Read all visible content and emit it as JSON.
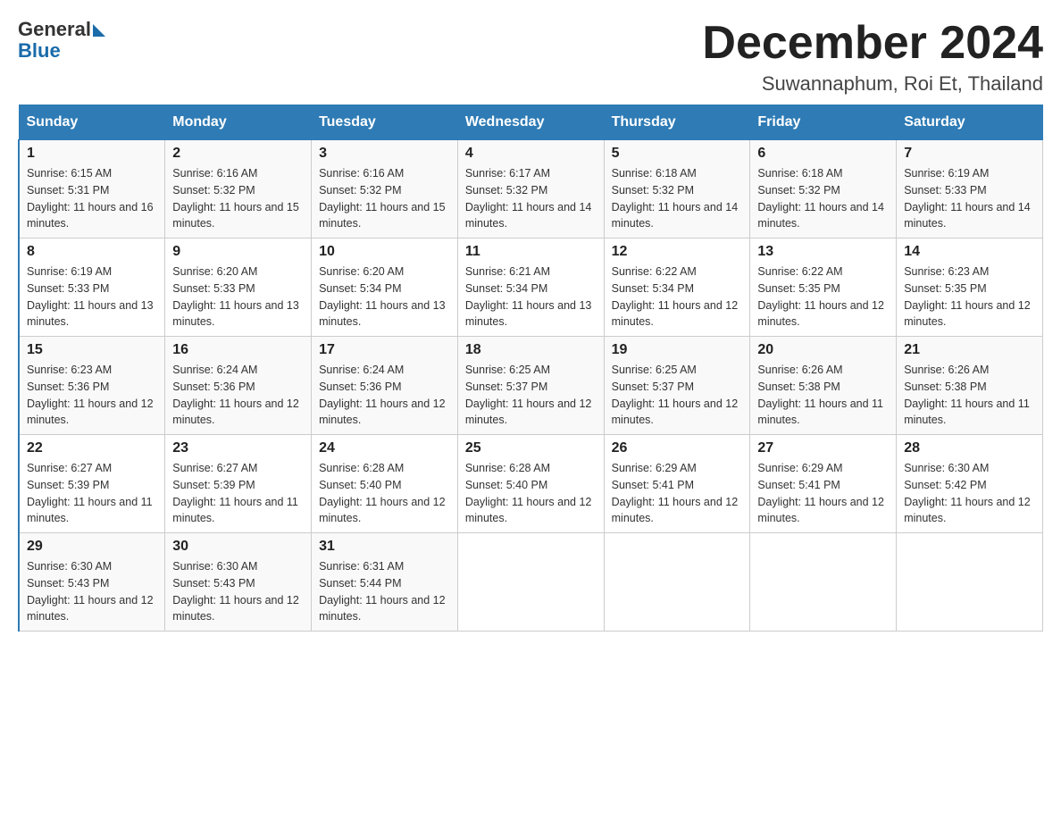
{
  "logo": {
    "general": "General",
    "blue": "Blue"
  },
  "title": "December 2024",
  "subtitle": "Suwannaphum, Roi Et, Thailand",
  "days_of_week": [
    "Sunday",
    "Monday",
    "Tuesday",
    "Wednesday",
    "Thursday",
    "Friday",
    "Saturday"
  ],
  "weeks": [
    [
      {
        "day": "1",
        "sunrise": "6:15 AM",
        "sunset": "5:31 PM",
        "daylight": "11 hours and 16 minutes."
      },
      {
        "day": "2",
        "sunrise": "6:16 AM",
        "sunset": "5:32 PM",
        "daylight": "11 hours and 15 minutes."
      },
      {
        "day": "3",
        "sunrise": "6:16 AM",
        "sunset": "5:32 PM",
        "daylight": "11 hours and 15 minutes."
      },
      {
        "day": "4",
        "sunrise": "6:17 AM",
        "sunset": "5:32 PM",
        "daylight": "11 hours and 14 minutes."
      },
      {
        "day": "5",
        "sunrise": "6:18 AM",
        "sunset": "5:32 PM",
        "daylight": "11 hours and 14 minutes."
      },
      {
        "day": "6",
        "sunrise": "6:18 AM",
        "sunset": "5:32 PM",
        "daylight": "11 hours and 14 minutes."
      },
      {
        "day": "7",
        "sunrise": "6:19 AM",
        "sunset": "5:33 PM",
        "daylight": "11 hours and 14 minutes."
      }
    ],
    [
      {
        "day": "8",
        "sunrise": "6:19 AM",
        "sunset": "5:33 PM",
        "daylight": "11 hours and 13 minutes."
      },
      {
        "day": "9",
        "sunrise": "6:20 AM",
        "sunset": "5:33 PM",
        "daylight": "11 hours and 13 minutes."
      },
      {
        "day": "10",
        "sunrise": "6:20 AM",
        "sunset": "5:34 PM",
        "daylight": "11 hours and 13 minutes."
      },
      {
        "day": "11",
        "sunrise": "6:21 AM",
        "sunset": "5:34 PM",
        "daylight": "11 hours and 13 minutes."
      },
      {
        "day": "12",
        "sunrise": "6:22 AM",
        "sunset": "5:34 PM",
        "daylight": "11 hours and 12 minutes."
      },
      {
        "day": "13",
        "sunrise": "6:22 AM",
        "sunset": "5:35 PM",
        "daylight": "11 hours and 12 minutes."
      },
      {
        "day": "14",
        "sunrise": "6:23 AM",
        "sunset": "5:35 PM",
        "daylight": "11 hours and 12 minutes."
      }
    ],
    [
      {
        "day": "15",
        "sunrise": "6:23 AM",
        "sunset": "5:36 PM",
        "daylight": "11 hours and 12 minutes."
      },
      {
        "day": "16",
        "sunrise": "6:24 AM",
        "sunset": "5:36 PM",
        "daylight": "11 hours and 12 minutes."
      },
      {
        "day": "17",
        "sunrise": "6:24 AM",
        "sunset": "5:36 PM",
        "daylight": "11 hours and 12 minutes."
      },
      {
        "day": "18",
        "sunrise": "6:25 AM",
        "sunset": "5:37 PM",
        "daylight": "11 hours and 12 minutes."
      },
      {
        "day": "19",
        "sunrise": "6:25 AM",
        "sunset": "5:37 PM",
        "daylight": "11 hours and 12 minutes."
      },
      {
        "day": "20",
        "sunrise": "6:26 AM",
        "sunset": "5:38 PM",
        "daylight": "11 hours and 11 minutes."
      },
      {
        "day": "21",
        "sunrise": "6:26 AM",
        "sunset": "5:38 PM",
        "daylight": "11 hours and 11 minutes."
      }
    ],
    [
      {
        "day": "22",
        "sunrise": "6:27 AM",
        "sunset": "5:39 PM",
        "daylight": "11 hours and 11 minutes."
      },
      {
        "day": "23",
        "sunrise": "6:27 AM",
        "sunset": "5:39 PM",
        "daylight": "11 hours and 11 minutes."
      },
      {
        "day": "24",
        "sunrise": "6:28 AM",
        "sunset": "5:40 PM",
        "daylight": "11 hours and 12 minutes."
      },
      {
        "day": "25",
        "sunrise": "6:28 AM",
        "sunset": "5:40 PM",
        "daylight": "11 hours and 12 minutes."
      },
      {
        "day": "26",
        "sunrise": "6:29 AM",
        "sunset": "5:41 PM",
        "daylight": "11 hours and 12 minutes."
      },
      {
        "day": "27",
        "sunrise": "6:29 AM",
        "sunset": "5:41 PM",
        "daylight": "11 hours and 12 minutes."
      },
      {
        "day": "28",
        "sunrise": "6:30 AM",
        "sunset": "5:42 PM",
        "daylight": "11 hours and 12 minutes."
      }
    ],
    [
      {
        "day": "29",
        "sunrise": "6:30 AM",
        "sunset": "5:43 PM",
        "daylight": "11 hours and 12 minutes."
      },
      {
        "day": "30",
        "sunrise": "6:30 AM",
        "sunset": "5:43 PM",
        "daylight": "11 hours and 12 minutes."
      },
      {
        "day": "31",
        "sunrise": "6:31 AM",
        "sunset": "5:44 PM",
        "daylight": "11 hours and 12 minutes."
      },
      null,
      null,
      null,
      null
    ]
  ]
}
